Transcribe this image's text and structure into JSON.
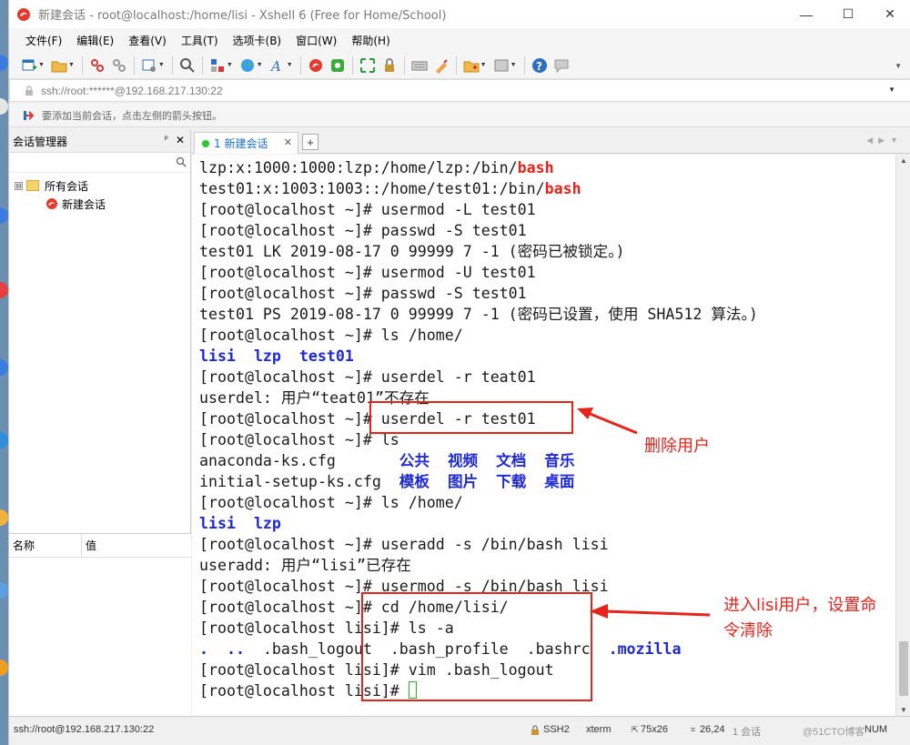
{
  "window": {
    "title": "新建会话 - root@localhost:/home/lisi - Xshell 6 (Free for Home/School)",
    "controls": {
      "minimize": "—",
      "maximize": "☐",
      "close": "✕"
    }
  },
  "menu": [
    "文件(F)",
    "编辑(E)",
    "查看(V)",
    "工具(T)",
    "选项卡(B)",
    "窗口(W)",
    "帮助(H)"
  ],
  "address": "ssh://root:******@192.168.217.130:22",
  "hint": "要添加当前会话，点击左侧的箭头按钮。",
  "session_manager": {
    "title": "会话管理器",
    "pin": "ᵖ",
    "close": "✕",
    "root_expander": "⊟",
    "root_label": "所有会话",
    "child_label": "新建会话",
    "props_col_name": "名称",
    "props_col_value": "值"
  },
  "tab": {
    "label": "1 新建会话",
    "close": "✕",
    "new": "+"
  },
  "terminal": {
    "lines": [
      [
        [
          "lzp:x:1000:1000:lzp:/home/lzp:/bin/",
          ""
        ],
        [
          "bash",
          "red"
        ]
      ],
      [
        [
          "test01:x:1003:1003::/home/test01:/bin/",
          ""
        ],
        [
          "bash",
          "red"
        ]
      ],
      [
        [
          "[root@localhost ~]# usermod -L test01",
          ""
        ]
      ],
      [
        [
          "[root@localhost ~]# passwd -S test01",
          ""
        ]
      ],
      [
        [
          "test01 LK 2019-08-17 0 99999 7 -1 (密码已被锁定。)",
          ""
        ]
      ],
      [
        [
          "[root@localhost ~]# usermod -U test01",
          ""
        ]
      ],
      [
        [
          "[root@localhost ~]# passwd -S test01",
          ""
        ]
      ],
      [
        [
          "test01 PS 2019-08-17 0 99999 7 -1 (密码已设置，使用 SHA512 算法。)",
          ""
        ]
      ],
      [
        [
          "[root@localhost ~]# ls /home/",
          ""
        ]
      ],
      [
        [
          "lisi  lzp  test01",
          "blue"
        ]
      ],
      [
        [
          "[root@localhost ~]# userdel -r teat01",
          ""
        ]
      ],
      [
        [
          "userdel: 用户“teat01”不存在",
          ""
        ]
      ],
      [
        [
          "[root@localhost ~]# userdel -r test01",
          ""
        ]
      ],
      [
        [
          "[root@localhost ~]# ls",
          ""
        ]
      ],
      [
        [
          "anaconda-ks.cfg       ",
          ""
        ],
        [
          "公共  视频  文档  音乐",
          "blue"
        ]
      ],
      [
        [
          "initial-setup-ks.cfg  ",
          ""
        ],
        [
          "模板  图片  下载  桌面",
          "blue"
        ]
      ],
      [
        [
          "[root@localhost ~]# ls /home/",
          ""
        ]
      ],
      [
        [
          "lisi  lzp",
          "blue"
        ]
      ],
      [
        [
          "[root@localhost ~]# useradd -s /bin/bash lisi",
          ""
        ]
      ],
      [
        [
          "useradd: 用户“lisi”已存在",
          ""
        ]
      ],
      [
        [
          "[root@localhost ~]# usermod -s /bin/bash lisi",
          ""
        ]
      ],
      [
        [
          "[root@localhost ~]# cd /home/lisi/",
          ""
        ]
      ],
      [
        [
          "[root@localhost lisi]# ls -a",
          ""
        ]
      ],
      [
        [
          ".  ..",
          "blue"
        ],
        [
          "  .bash_logout  .bash_profile  .bashrc  ",
          ""
        ],
        [
          ".mozilla",
          "blue"
        ]
      ],
      [
        [
          "[root@localhost lisi]# vim .bash_logout",
          ""
        ]
      ],
      [
        [
          "[root@localhost lisi]# ",
          ""
        ]
      ]
    ]
  },
  "annotations": {
    "delete_user": "删除用户",
    "enter_user_line1": "进入lisi用户，设置命",
    "enter_user_line2": "令清除"
  },
  "status": {
    "connection": "ssh://root@192.168.217.130:22",
    "protocol": "SSH2",
    "terminal_type": "xterm",
    "size": "75x26",
    "cursor_pos": "26,24",
    "sessions": "1 会话",
    "watermark": "@51CTO博客",
    "num": "NUM"
  },
  "colors": {
    "annotation_red": "#e8231a",
    "ls_blue": "#1e2ad6",
    "tab_blue": "#1a6fd1"
  }
}
